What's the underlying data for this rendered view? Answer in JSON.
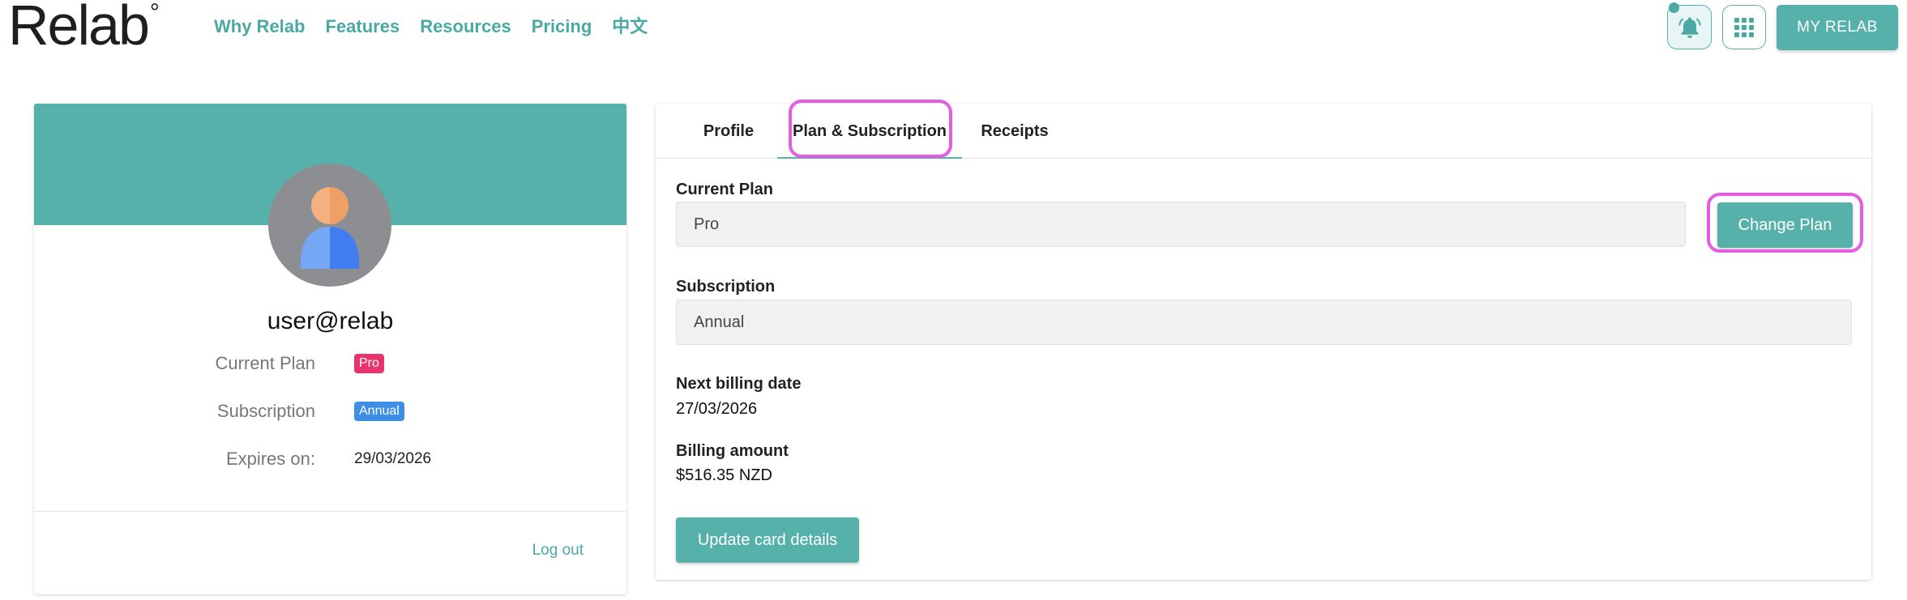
{
  "header": {
    "logo": "Relab",
    "logo_ring": "°",
    "nav": [
      {
        "label": "Why Relab"
      },
      {
        "label": "Features"
      },
      {
        "label": "Resources"
      },
      {
        "label": "Pricing"
      },
      {
        "label": "中文"
      }
    ],
    "my_relab_label": "MY RELAB"
  },
  "profile": {
    "username": "user@relab",
    "rows": [
      {
        "label": "Current Plan",
        "value": "Pro"
      },
      {
        "label": "Subscription",
        "value": "Annual"
      },
      {
        "label": "Expires on:",
        "value": "29/03/2026"
      }
    ],
    "logout_label": "Log out"
  },
  "settings": {
    "tabs": [
      {
        "label": "Profile",
        "active": false
      },
      {
        "label": "Plan & Subscription",
        "active": true
      },
      {
        "label": "Receipts",
        "active": false
      }
    ],
    "current_plan_label": "Current Plan",
    "current_plan_value": "Pro",
    "change_plan_label": "Change Plan",
    "subscription_label": "Subscription",
    "subscription_value": "Annual",
    "next_billing_label": "Next billing date",
    "next_billing_value": "27/03/2026",
    "billing_amount_label": "Billing amount",
    "billing_amount_value": "$516.35 NZD",
    "update_card_label": "Update card details"
  },
  "colors": {
    "accent": "#57b1ab",
    "nav_text": "#4aa9a3",
    "highlight": "#e35ce3",
    "badge_pro": "#e8336d",
    "badge_annual": "#3e8ee5"
  },
  "icons": {
    "notifications": "bell-icon",
    "apps": "grid-icon",
    "avatar": "user-avatar-icon"
  }
}
